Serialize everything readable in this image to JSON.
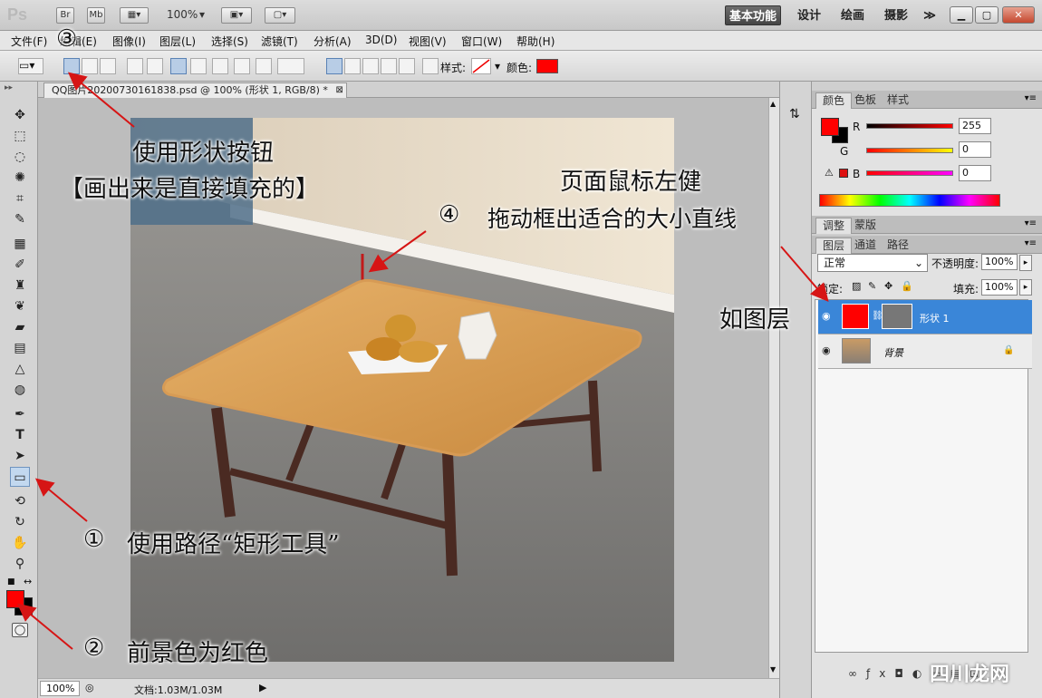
{
  "titlebar": {
    "logo": "Ps",
    "br": "Br",
    "mb": "Mb",
    "zoom": "100%",
    "workspaces": [
      "基本功能",
      "设计",
      "绘画",
      "摄影"
    ],
    "more": "≫"
  },
  "menu": [
    "文件(F)",
    "编辑(E)",
    "图像(I)",
    "图层(L)",
    "选择(S)",
    "滤镜(T)",
    "分析(A)",
    "3D(D)",
    "视图(V)",
    "窗口(W)",
    "帮助(H)"
  ],
  "options": {
    "style_label": "样式:",
    "color_label": "颜色:",
    "color": "#ff0000"
  },
  "document": {
    "tab_title": "QQ图片20200730161838.psd @ 100% (形状 1, RGB/8) *",
    "status_zoom": "100%",
    "status_doc": "文档:1.03M/1.03M"
  },
  "color_panel": {
    "tabs": [
      "颜色",
      "色板",
      "样式"
    ],
    "r_label": "R",
    "g_label": "G",
    "b_label": "B",
    "r": "255",
    "g": "0",
    "b": "0",
    "foreground": "#ff0000",
    "background": "#000000"
  },
  "adjust_tabs": [
    "调整",
    "蒙版"
  ],
  "layers_panel": {
    "tabs": [
      "图层",
      "通道",
      "路径"
    ],
    "blend_mode": "正常",
    "opacity_label": "不透明度:",
    "opacity": "100%",
    "lock_label": "锁定:",
    "fill_label": "填充:",
    "fill": "100%",
    "layers": [
      {
        "name": "形状 1",
        "selected": true
      },
      {
        "name": "背景",
        "selected": false
      }
    ]
  },
  "annotations": {
    "step3": "③",
    "step3_text1": "使用形状按钮",
    "step3_text2": "【画出来是直接填充的】",
    "step4": "④",
    "step4_text1": "页面鼠标左健",
    "step4_text2": "拖动框出适合的大小直线",
    "layer_note": "如图层",
    "step1": "①",
    "step1_text": "使用路径“矩形工具”",
    "step2": "②",
    "step2_text": "前景色为红色"
  },
  "watermark": "四川龙网"
}
